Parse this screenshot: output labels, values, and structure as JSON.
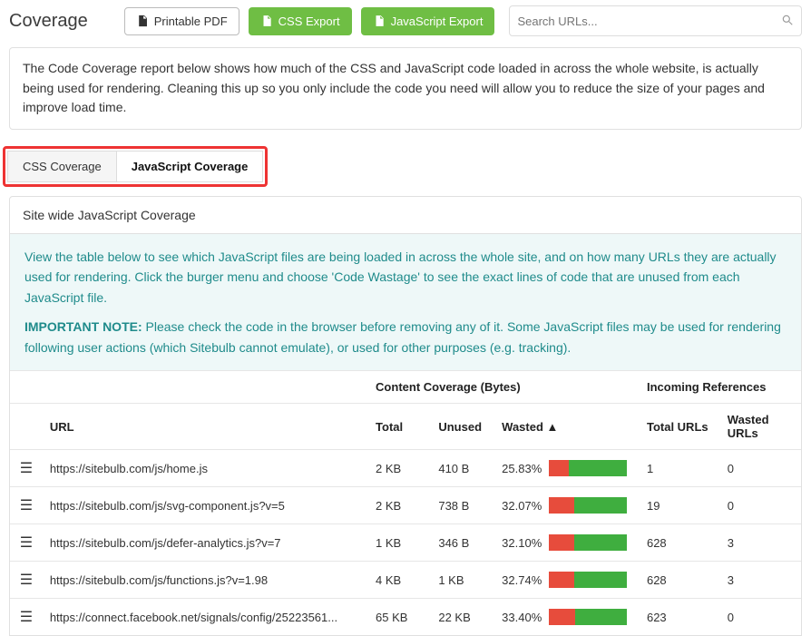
{
  "header": {
    "title": "Coverage",
    "printable_pdf": "Printable PDF",
    "css_export": "CSS Export",
    "js_export": "JavaScript Export",
    "search_placeholder": "Search URLs..."
  },
  "description": "The Code Coverage report below shows how much of the CSS and JavaScript code loaded in across the whole website, is actually being used for rendering. Cleaning this up so you only include the code you need will allow you to reduce the size of your pages and improve load time.",
  "tabs": {
    "css": "CSS Coverage",
    "js": "JavaScript Coverage"
  },
  "panel": {
    "title": "Site wide JavaScript Coverage",
    "info_p1": "View the table below to see which JavaScript files are being loaded in across the whole site, and on how many URLs they are actually used for rendering. Click the burger menu and choose 'Code Wastage' to see the exact lines of code that are unused from each JavaScript file.",
    "info_important_label": "IMPORTANT NOTE:",
    "info_p2": " Please check the code in the browser before removing any of it. Some JavaScript files may be used for rendering following user actions (which Sitebulb cannot emulate), or used for other purposes (e.g. tracking)."
  },
  "table": {
    "group_content": "Content Coverage (Bytes)",
    "group_incoming": "Incoming References",
    "col_url": "URL",
    "col_total": "Total",
    "col_unused": "Unused",
    "col_wasted": "Wasted ▲",
    "col_total_urls": "Total URLs",
    "col_wasted_urls": "Wasted URLs",
    "rows": [
      {
        "url": "https://sitebulb.com/js/home.js",
        "total": "2 KB",
        "unused": "410 B",
        "wasted_pct": "25.83%",
        "wasted_frac": 0.2583,
        "total_urls": "1",
        "wasted_urls": "0"
      },
      {
        "url": "https://sitebulb.com/js/svg-component.js?v=5",
        "total": "2 KB",
        "unused": "738 B",
        "wasted_pct": "32.07%",
        "wasted_frac": 0.3207,
        "total_urls": "19",
        "wasted_urls": "0"
      },
      {
        "url": "https://sitebulb.com/js/defer-analytics.js?v=7",
        "total": "1 KB",
        "unused": "346 B",
        "wasted_pct": "32.10%",
        "wasted_frac": 0.321,
        "total_urls": "628",
        "wasted_urls": "3"
      },
      {
        "url": "https://sitebulb.com/js/functions.js?v=1.98",
        "total": "4 KB",
        "unused": "1 KB",
        "wasted_pct": "32.74%",
        "wasted_frac": 0.3274,
        "total_urls": "628",
        "wasted_urls": "3"
      },
      {
        "url": "https://connect.facebook.net/signals/config/25223561...",
        "total": "65 KB",
        "unused": "22 KB",
        "wasted_pct": "33.40%",
        "wasted_frac": 0.334,
        "total_urls": "623",
        "wasted_urls": "0"
      }
    ]
  }
}
